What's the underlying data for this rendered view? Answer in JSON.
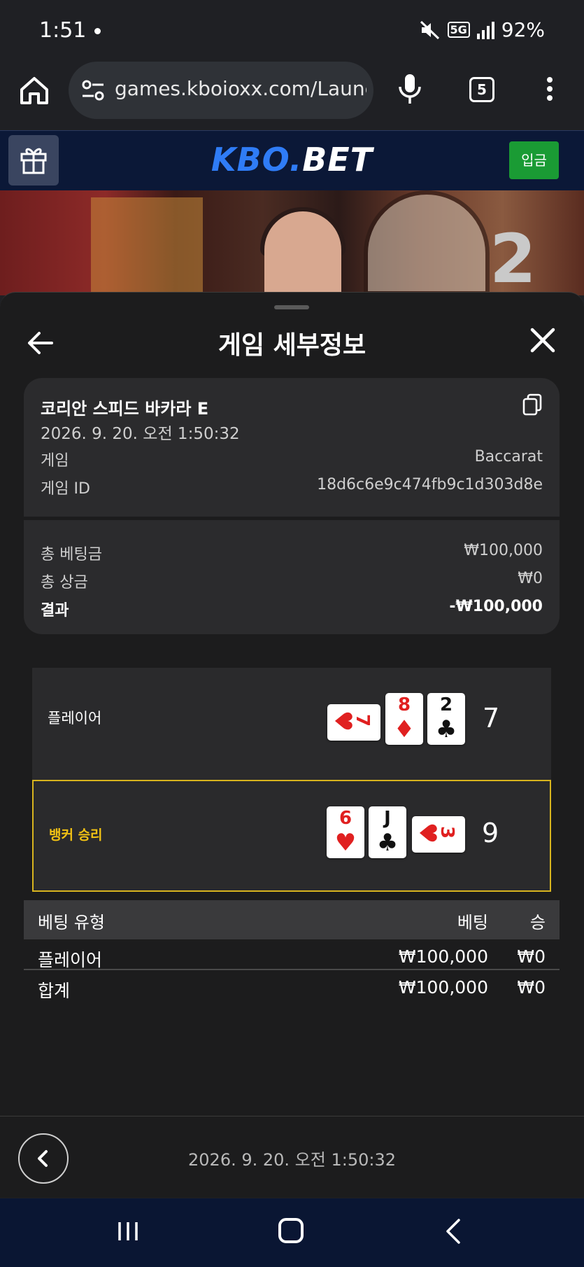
{
  "status_bar": {
    "time": "1:51",
    "battery": "92%",
    "network": "5G"
  },
  "browser": {
    "url": "games.kboioxx.com/Launc",
    "tab_count": "5"
  },
  "site": {
    "logo_kbo": "KBO",
    "logo_dot": ".",
    "logo_bet": "BET",
    "deposit_label": "입금"
  },
  "video": {
    "overlay_number": "2"
  },
  "sheet": {
    "title": "게임 세부정보",
    "game_name": "코리안 스피드 바카라 E",
    "date": "2026. 9. 20. 오전 1:50:32",
    "game_label": "게임",
    "game_value": "Baccarat",
    "game_id_label": "게임 ID",
    "game_id_value": "18d6c6e9c474fb9c1d303d8e",
    "total_bet_label": "총 베팅금",
    "total_bet_value": "₩100,000",
    "total_win_label": "총 상금",
    "total_win_value": "₩0",
    "result_label": "결과",
    "result_value": "-₩100,000"
  },
  "hands": {
    "player": {
      "label": "플레이어",
      "score": "7",
      "cards": [
        {
          "rank": "7",
          "suit": "♥",
          "color": "red",
          "sideways": true
        },
        {
          "rank": "8",
          "suit": "♦",
          "color": "red",
          "sideways": false
        },
        {
          "rank": "2",
          "suit": "♣",
          "color": "black",
          "sideways": false
        }
      ]
    },
    "banker": {
      "label": "뱅커 승리",
      "score": "9",
      "cards": [
        {
          "rank": "6",
          "suit": "♥",
          "color": "red",
          "sideways": false
        },
        {
          "rank": "J",
          "suit": "♣",
          "color": "black",
          "sideways": false
        },
        {
          "rank": "3",
          "suit": "♥",
          "color": "red",
          "sideways": true
        }
      ]
    }
  },
  "bet_table": {
    "headers": [
      "베팅 유형",
      "베팅",
      "승"
    ],
    "rows": [
      [
        "플레이어",
        "₩100,000",
        "₩0"
      ],
      [
        "합계",
        "₩100,000",
        "₩0"
      ]
    ]
  },
  "footer": {
    "date": "2026. 9. 20. 오전 1:50:32"
  },
  "colors": {
    "accent_gold": "#d8b41e",
    "deposit_green": "#1a9b34",
    "logo_blue": "#2f7cf6",
    "card_red": "#e02020"
  },
  "icons": [
    "home-icon",
    "site-settings-icon",
    "mic-icon",
    "tabs-icon",
    "more-vert-icon",
    "gift-icon",
    "back-arrow-icon",
    "close-icon",
    "copy-icon",
    "chevron-left-icon",
    "recent-apps-icon",
    "home-nav-icon",
    "back-nav-icon",
    "mute-icon",
    "signal-icon"
  ]
}
